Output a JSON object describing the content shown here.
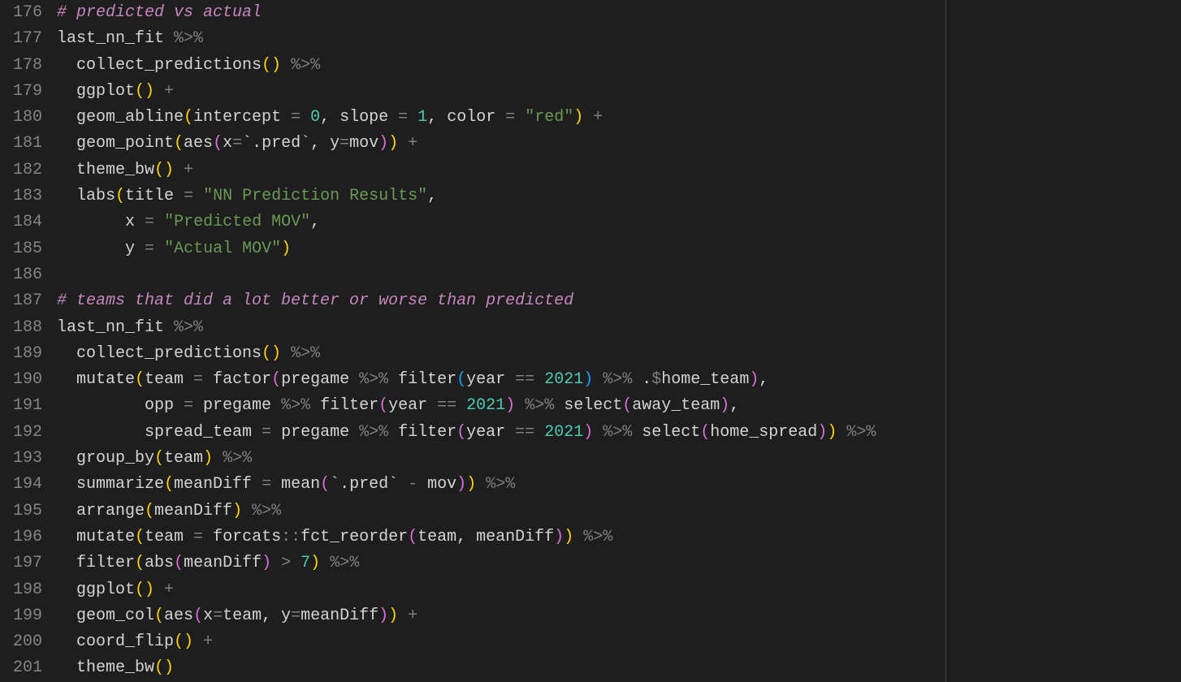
{
  "gutter": {
    "start": 176,
    "end": 201
  },
  "lines": [
    [
      {
        "c": "tok-comment",
        "t": "# predicted vs actual"
      }
    ],
    [
      {
        "c": "tok-ident",
        "t": "last_nn_fit "
      },
      {
        "c": "tok-pipe",
        "t": "%>%"
      }
    ],
    [
      {
        "c": "tok-ident",
        "t": "  collect_predictions"
      },
      {
        "c": "tok-paren",
        "t": "()"
      },
      {
        "c": "tok-ident",
        "t": " "
      },
      {
        "c": "tok-pipe",
        "t": "%>%"
      }
    ],
    [
      {
        "c": "tok-ident",
        "t": "  ggplot"
      },
      {
        "c": "tok-paren",
        "t": "()"
      },
      {
        "c": "tok-ident",
        "t": " "
      },
      {
        "c": "tok-op",
        "t": "+"
      }
    ],
    [
      {
        "c": "tok-ident",
        "t": "  geom_abline"
      },
      {
        "c": "tok-paren",
        "t": "("
      },
      {
        "c": "tok-ident",
        "t": "intercept "
      },
      {
        "c": "tok-op",
        "t": "="
      },
      {
        "c": "tok-ident",
        "t": " "
      },
      {
        "c": "tok-num",
        "t": "0"
      },
      {
        "c": "tok-ident",
        "t": ", slope "
      },
      {
        "c": "tok-op",
        "t": "="
      },
      {
        "c": "tok-ident",
        "t": " "
      },
      {
        "c": "tok-num",
        "t": "1"
      },
      {
        "c": "tok-ident",
        "t": ", color "
      },
      {
        "c": "tok-op",
        "t": "="
      },
      {
        "c": "tok-ident",
        "t": " "
      },
      {
        "c": "tok-str",
        "t": "\"red\""
      },
      {
        "c": "tok-paren",
        "t": ")"
      },
      {
        "c": "tok-ident",
        "t": " "
      },
      {
        "c": "tok-op",
        "t": "+"
      }
    ],
    [
      {
        "c": "tok-ident",
        "t": "  geom_point"
      },
      {
        "c": "tok-paren",
        "t": "("
      },
      {
        "c": "tok-ident",
        "t": "aes"
      },
      {
        "c": "tok-paren2",
        "t": "("
      },
      {
        "c": "tok-ident",
        "t": "x"
      },
      {
        "c": "tok-op",
        "t": "="
      },
      {
        "c": "tok-ident",
        "t": "`.pred`, y"
      },
      {
        "c": "tok-op",
        "t": "="
      },
      {
        "c": "tok-ident",
        "t": "mov"
      },
      {
        "c": "tok-paren2",
        "t": ")"
      },
      {
        "c": "tok-paren",
        "t": ")"
      },
      {
        "c": "tok-ident",
        "t": " "
      },
      {
        "c": "tok-op",
        "t": "+"
      }
    ],
    [
      {
        "c": "tok-ident",
        "t": "  theme_bw"
      },
      {
        "c": "tok-paren",
        "t": "()"
      },
      {
        "c": "tok-ident",
        "t": " "
      },
      {
        "c": "tok-op",
        "t": "+"
      }
    ],
    [
      {
        "c": "tok-ident",
        "t": "  labs"
      },
      {
        "c": "tok-paren",
        "t": "("
      },
      {
        "c": "tok-ident",
        "t": "title "
      },
      {
        "c": "tok-op",
        "t": "="
      },
      {
        "c": "tok-ident",
        "t": " "
      },
      {
        "c": "tok-str",
        "t": "\"NN Prediction Results\""
      },
      {
        "c": "tok-ident",
        "t": ","
      }
    ],
    [
      {
        "c": "tok-ident",
        "t": "       x "
      },
      {
        "c": "tok-op",
        "t": "="
      },
      {
        "c": "tok-ident",
        "t": " "
      },
      {
        "c": "tok-str",
        "t": "\"Predicted MOV\""
      },
      {
        "c": "tok-ident",
        "t": ","
      }
    ],
    [
      {
        "c": "tok-ident",
        "t": "       y "
      },
      {
        "c": "tok-op",
        "t": "="
      },
      {
        "c": "tok-ident",
        "t": " "
      },
      {
        "c": "tok-str",
        "t": "\"Actual MOV\""
      },
      {
        "c": "tok-paren",
        "t": ")"
      }
    ],
    [
      {
        "c": "tok-ident",
        "t": ""
      }
    ],
    [
      {
        "c": "tok-comment",
        "t": "# teams that did a lot better or worse than predicted"
      }
    ],
    [
      {
        "c": "tok-ident",
        "t": "last_nn_fit "
      },
      {
        "c": "tok-pipe",
        "t": "%>%"
      }
    ],
    [
      {
        "c": "tok-ident",
        "t": "  collect_predictions"
      },
      {
        "c": "tok-paren",
        "t": "()"
      },
      {
        "c": "tok-ident",
        "t": " "
      },
      {
        "c": "tok-pipe",
        "t": "%>%"
      }
    ],
    [
      {
        "c": "tok-ident",
        "t": "  mutate"
      },
      {
        "c": "tok-paren",
        "t": "("
      },
      {
        "c": "tok-ident",
        "t": "team "
      },
      {
        "c": "tok-op",
        "t": "="
      },
      {
        "c": "tok-ident",
        "t": " factor"
      },
      {
        "c": "tok-paren2",
        "t": "("
      },
      {
        "c": "tok-ident",
        "t": "pregame "
      },
      {
        "c": "tok-pipe",
        "t": "%>%"
      },
      {
        "c": "tok-ident",
        "t": " filter"
      },
      {
        "c": "tok-paren3",
        "t": "("
      },
      {
        "c": "tok-ident",
        "t": "year "
      },
      {
        "c": "tok-op",
        "t": "=="
      },
      {
        "c": "tok-ident",
        "t": " "
      },
      {
        "c": "tok-num",
        "t": "2021"
      },
      {
        "c": "tok-paren3",
        "t": ")"
      },
      {
        "c": "tok-ident",
        "t": " "
      },
      {
        "c": "tok-pipe",
        "t": "%>%"
      },
      {
        "c": "tok-ident",
        "t": " ."
      },
      {
        "c": "tok-dollar",
        "t": "$"
      },
      {
        "c": "tok-ident",
        "t": "home_team"
      },
      {
        "c": "tok-paren2",
        "t": ")"
      },
      {
        "c": "tok-ident",
        "t": ","
      }
    ],
    [
      {
        "c": "tok-ident",
        "t": "         opp "
      },
      {
        "c": "tok-op",
        "t": "="
      },
      {
        "c": "tok-ident",
        "t": " pregame "
      },
      {
        "c": "tok-pipe",
        "t": "%>%"
      },
      {
        "c": "tok-ident",
        "t": " filter"
      },
      {
        "c": "tok-paren2",
        "t": "("
      },
      {
        "c": "tok-ident",
        "t": "year "
      },
      {
        "c": "tok-op",
        "t": "=="
      },
      {
        "c": "tok-ident",
        "t": " "
      },
      {
        "c": "tok-num",
        "t": "2021"
      },
      {
        "c": "tok-paren2",
        "t": ")"
      },
      {
        "c": "tok-ident",
        "t": " "
      },
      {
        "c": "tok-pipe",
        "t": "%>%"
      },
      {
        "c": "tok-ident",
        "t": " select"
      },
      {
        "c": "tok-paren2",
        "t": "("
      },
      {
        "c": "tok-ident",
        "t": "away_team"
      },
      {
        "c": "tok-paren2",
        "t": ")"
      },
      {
        "c": "tok-ident",
        "t": ","
      }
    ],
    [
      {
        "c": "tok-ident",
        "t": "         spread_team "
      },
      {
        "c": "tok-op",
        "t": "="
      },
      {
        "c": "tok-ident",
        "t": " pregame "
      },
      {
        "c": "tok-pipe",
        "t": "%>%"
      },
      {
        "c": "tok-ident",
        "t": " filter"
      },
      {
        "c": "tok-paren2",
        "t": "("
      },
      {
        "c": "tok-ident",
        "t": "year "
      },
      {
        "c": "tok-op",
        "t": "=="
      },
      {
        "c": "tok-ident",
        "t": " "
      },
      {
        "c": "tok-num",
        "t": "2021"
      },
      {
        "c": "tok-paren2",
        "t": ")"
      },
      {
        "c": "tok-ident",
        "t": " "
      },
      {
        "c": "tok-pipe",
        "t": "%>%"
      },
      {
        "c": "tok-ident",
        "t": " select"
      },
      {
        "c": "tok-paren2",
        "t": "("
      },
      {
        "c": "tok-ident",
        "t": "home_spread"
      },
      {
        "c": "tok-paren2",
        "t": ")"
      },
      {
        "c": "tok-paren",
        "t": ")"
      },
      {
        "c": "tok-ident",
        "t": " "
      },
      {
        "c": "tok-pipe",
        "t": "%>%"
      }
    ],
    [
      {
        "c": "tok-ident",
        "t": "  group_by"
      },
      {
        "c": "tok-paren",
        "t": "("
      },
      {
        "c": "tok-ident",
        "t": "team"
      },
      {
        "c": "tok-paren",
        "t": ")"
      },
      {
        "c": "tok-ident",
        "t": " "
      },
      {
        "c": "tok-pipe",
        "t": "%>%"
      }
    ],
    [
      {
        "c": "tok-ident",
        "t": "  summarize"
      },
      {
        "c": "tok-paren",
        "t": "("
      },
      {
        "c": "tok-ident",
        "t": "meanDiff "
      },
      {
        "c": "tok-op",
        "t": "="
      },
      {
        "c": "tok-ident",
        "t": " mean"
      },
      {
        "c": "tok-paren2",
        "t": "("
      },
      {
        "c": "tok-ident",
        "t": "`.pred` "
      },
      {
        "c": "tok-op",
        "t": "-"
      },
      {
        "c": "tok-ident",
        "t": " mov"
      },
      {
        "c": "tok-paren2",
        "t": ")"
      },
      {
        "c": "tok-paren",
        "t": ")"
      },
      {
        "c": "tok-ident",
        "t": " "
      },
      {
        "c": "tok-pipe",
        "t": "%>%"
      }
    ],
    [
      {
        "c": "tok-ident",
        "t": "  arrange"
      },
      {
        "c": "tok-paren",
        "t": "("
      },
      {
        "c": "tok-ident",
        "t": "meanDiff"
      },
      {
        "c": "tok-paren",
        "t": ")"
      },
      {
        "c": "tok-ident",
        "t": " "
      },
      {
        "c": "tok-pipe",
        "t": "%>%"
      }
    ],
    [
      {
        "c": "tok-ident",
        "t": "  mutate"
      },
      {
        "c": "tok-paren",
        "t": "("
      },
      {
        "c": "tok-ident",
        "t": "team "
      },
      {
        "c": "tok-op",
        "t": "="
      },
      {
        "c": "tok-ident",
        "t": " forcats"
      },
      {
        "c": "tok-ns",
        "t": "::"
      },
      {
        "c": "tok-ident",
        "t": "fct_reorder"
      },
      {
        "c": "tok-paren2",
        "t": "("
      },
      {
        "c": "tok-ident",
        "t": "team, meanDiff"
      },
      {
        "c": "tok-paren2",
        "t": ")"
      },
      {
        "c": "tok-paren",
        "t": ")"
      },
      {
        "c": "tok-ident",
        "t": " "
      },
      {
        "c": "tok-pipe",
        "t": "%>%"
      }
    ],
    [
      {
        "c": "tok-ident",
        "t": "  filter"
      },
      {
        "c": "tok-paren",
        "t": "("
      },
      {
        "c": "tok-ident",
        "t": "abs"
      },
      {
        "c": "tok-paren2",
        "t": "("
      },
      {
        "c": "tok-ident",
        "t": "meanDiff"
      },
      {
        "c": "tok-paren2",
        "t": ")"
      },
      {
        "c": "tok-ident",
        "t": " "
      },
      {
        "c": "tok-op",
        "t": ">"
      },
      {
        "c": "tok-ident",
        "t": " "
      },
      {
        "c": "tok-num",
        "t": "7"
      },
      {
        "c": "tok-paren",
        "t": ")"
      },
      {
        "c": "tok-ident",
        "t": " "
      },
      {
        "c": "tok-pipe",
        "t": "%>%"
      }
    ],
    [
      {
        "c": "tok-ident",
        "t": "  ggplot"
      },
      {
        "c": "tok-paren",
        "t": "()"
      },
      {
        "c": "tok-ident",
        "t": " "
      },
      {
        "c": "tok-op",
        "t": "+"
      }
    ],
    [
      {
        "c": "tok-ident",
        "t": "  geom_col"
      },
      {
        "c": "tok-paren",
        "t": "("
      },
      {
        "c": "tok-ident",
        "t": "aes"
      },
      {
        "c": "tok-paren2",
        "t": "("
      },
      {
        "c": "tok-ident",
        "t": "x"
      },
      {
        "c": "tok-op",
        "t": "="
      },
      {
        "c": "tok-ident",
        "t": "team, y"
      },
      {
        "c": "tok-op",
        "t": "="
      },
      {
        "c": "tok-ident",
        "t": "meanDiff"
      },
      {
        "c": "tok-paren2",
        "t": ")"
      },
      {
        "c": "tok-paren",
        "t": ")"
      },
      {
        "c": "tok-ident",
        "t": " "
      },
      {
        "c": "tok-op",
        "t": "+"
      }
    ],
    [
      {
        "c": "tok-ident",
        "t": "  coord_flip"
      },
      {
        "c": "tok-paren",
        "t": "()"
      },
      {
        "c": "tok-ident",
        "t": " "
      },
      {
        "c": "tok-op",
        "t": "+"
      }
    ],
    [
      {
        "c": "tok-ident",
        "t": "  theme_bw"
      },
      {
        "c": "tok-paren",
        "t": "()"
      }
    ]
  ]
}
